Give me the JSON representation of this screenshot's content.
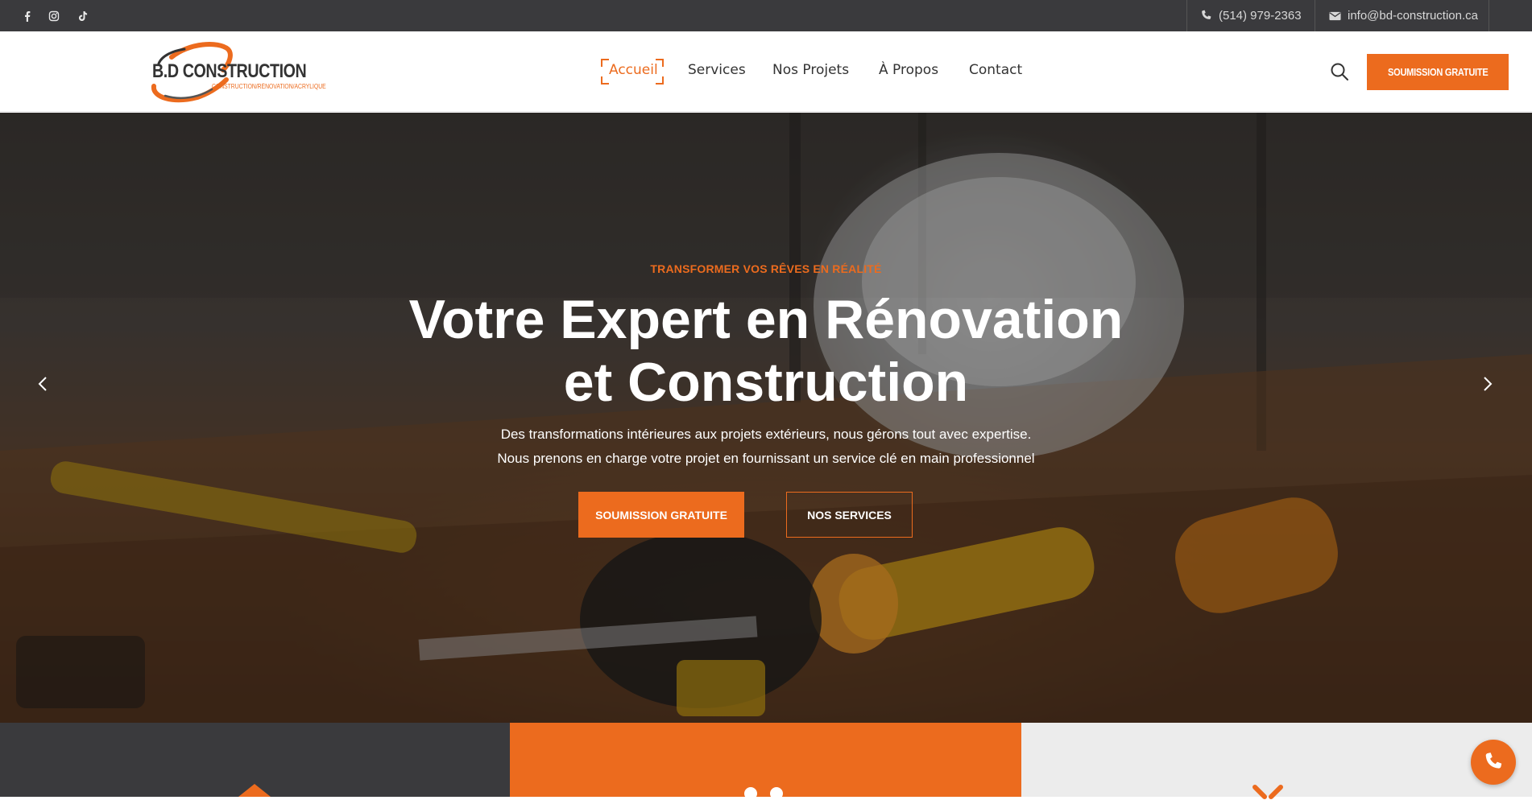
{
  "topbar": {
    "social": [
      {
        "icon": "facebook-icon"
      },
      {
        "icon": "instagram-icon"
      },
      {
        "icon": "tiktok-icon"
      }
    ],
    "phone": "(514) 979-2363",
    "email": "info@bd-construction.ca"
  },
  "header": {
    "logo_name": "B.D CONSTRUCTION",
    "logo_tagline": "CONSTRUCTION/RÉNOVATION/ACRYLIQUE",
    "nav": [
      {
        "label": "Accueil",
        "active": true
      },
      {
        "label": "Services",
        "active": false
      },
      {
        "label": "Nos Projets",
        "active": false
      },
      {
        "label": "À Propos",
        "active": false
      },
      {
        "label": "Contact",
        "active": false
      }
    ],
    "cta_label": "SOUMISSION GRATUITE"
  },
  "hero": {
    "kicker": "TRANSFORMER VOS RÊVES EN RÉALITÉ",
    "title_line1": "Votre Expert en Rénovation",
    "title_line2": "et Construction",
    "subtitle_line1": "Des transformations intérieures aux projets extérieurs, nous gérons tout avec expertise.",
    "subtitle_line2": "Nous prenons en charge votre projet en fournissant un service clé en main professionnel",
    "primary_button": "SOUMISSION GRATUITE",
    "secondary_button": "NOS SERVICES"
  },
  "colors": {
    "accent": "#ec6b1e",
    "dark": "#3a3a3d",
    "light": "#ececec"
  }
}
